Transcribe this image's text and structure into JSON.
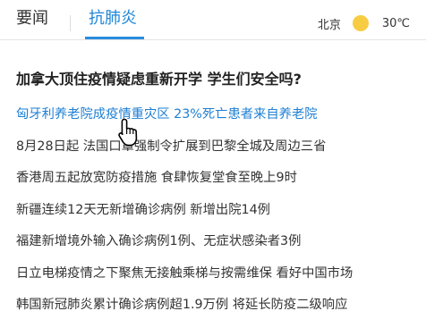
{
  "tabs": [
    {
      "label": "要闻"
    },
    {
      "label": "抗肺炎"
    }
  ],
  "weather": {
    "city": "北京",
    "icon": "sun-icon",
    "temperature": "30℃"
  },
  "headline": "加拿大顶住疫情疑虑重新开学 学生们安全吗?",
  "news": [
    "匈牙利养老院成疫情重灾区 23%死亡患者来自养老院",
    "8月28日起 法国口罩强制令扩展到巴黎全城及周边三省",
    "香港周五起放宽防疫措施 食肆恢复堂食至晚上9时",
    "新疆连续12天无新增确诊病例 新增出院14例",
    "福建新增境外输入确诊病例1例、无症状感染者3例",
    "日立电梯疫情之下聚焦无接触乘梯与按需维保 看好中国市场",
    "韩国新冠肺炎累计确诊病例超1.9万例 将延长防疫二级响应"
  ],
  "colors": {
    "accent": "#1e86d8",
    "sun": "#f7cc42"
  }
}
